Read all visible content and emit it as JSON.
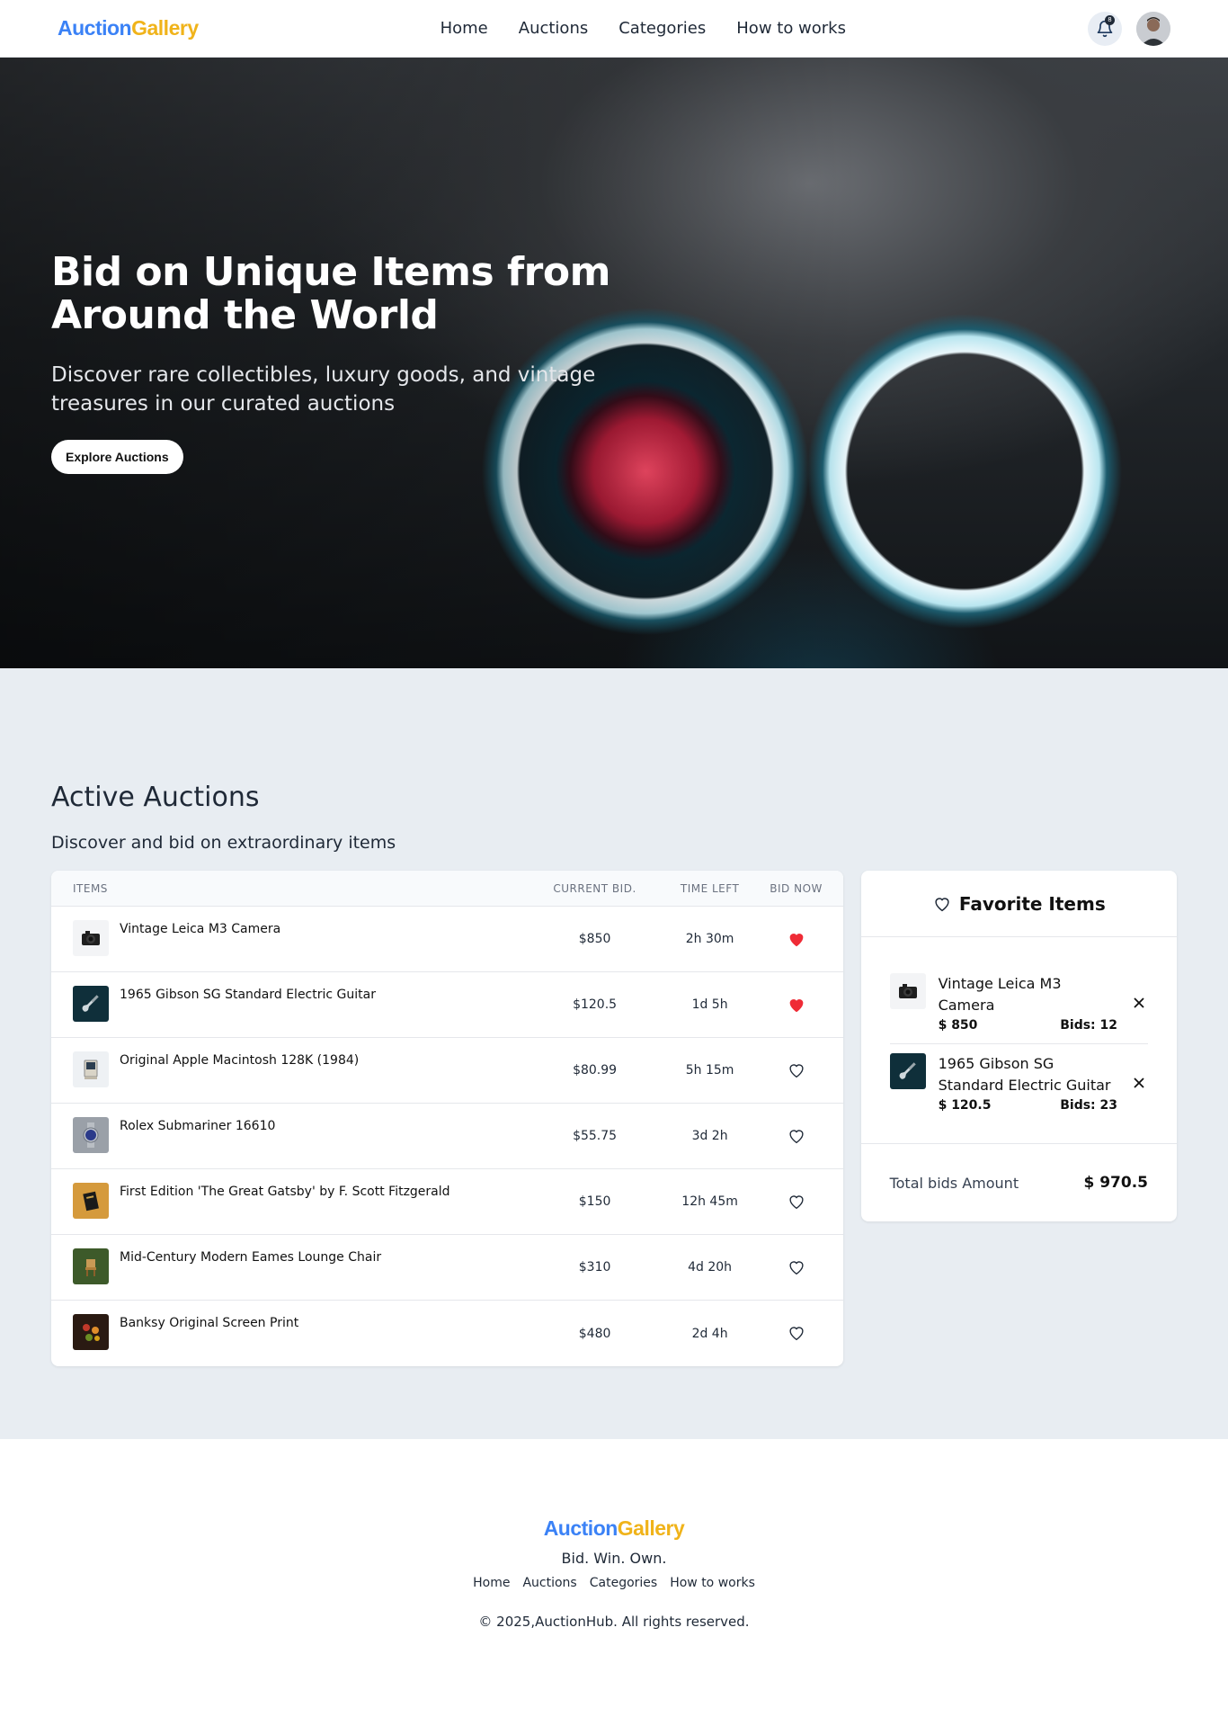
{
  "header": {
    "logo_part1": "Auction",
    "logo_part2": "Gallery",
    "nav": [
      "Home",
      "Auctions",
      "Categories",
      "How to works"
    ],
    "notification_count": "8"
  },
  "hero": {
    "title": "Bid on Unique Items from Around the World",
    "subtitle": "Discover rare collectibles, luxury goods, and vintage treasures in our curated auctions",
    "cta": "Explore Auctions"
  },
  "auctions": {
    "title": "Active Auctions",
    "subtitle": "Discover and bid on extraordinary items",
    "columns": {
      "items": "ITEMS",
      "current_bid": "CURRENT BID.",
      "time_left": "TIME LEFT",
      "bid_now": "BID NOW"
    },
    "rows": [
      {
        "name": "Vintage Leica M3 Camera",
        "bid": "$850",
        "time": "2h 30m",
        "favorite": true
      },
      {
        "name": "1965 Gibson SG Standard Electric Guitar",
        "bid": "$120.5",
        "time": "1d 5h",
        "favorite": true
      },
      {
        "name": "Original Apple Macintosh 128K (1984)",
        "bid": "$80.99",
        "time": "5h 15m",
        "favorite": false
      },
      {
        "name": "Rolex Submariner 16610",
        "bid": "$55.75",
        "time": "3d 2h",
        "favorite": false
      },
      {
        "name": "First Edition 'The Great Gatsby' by F. Scott Fitzgerald",
        "bid": "$150",
        "time": "12h 45m",
        "favorite": false
      },
      {
        "name": "Mid-Century Modern Eames Lounge Chair",
        "bid": "$310",
        "time": "4d 20h",
        "favorite": false
      },
      {
        "name": "Banksy Original Screen Print",
        "bid": "$480",
        "time": "2d 4h",
        "favorite": false
      }
    ]
  },
  "favorites": {
    "title": "Favorite Items",
    "items": [
      {
        "name": "Vintage Leica M3 Camera",
        "price": "$ 850",
        "bids": "Bids: 12"
      },
      {
        "name": "1965 Gibson SG Standard Electric Guitar",
        "price": "$ 120.5",
        "bids": "Bids: 23"
      }
    ],
    "total_label": "Total bids Amount",
    "total_amount": "$ 970.5"
  },
  "footer": {
    "tagline": "Bid. Win. Own.",
    "links": [
      "Home",
      "Auctions",
      "Categories",
      "How to works"
    ],
    "copyright": "© 2025,AuctionHub. All rights reserved."
  },
  "colors": {
    "brand_blue": "#3b82f6",
    "brand_gold": "#f0b31a",
    "heart_red": "#ef2b36",
    "section_bg": "#e8edf2"
  }
}
